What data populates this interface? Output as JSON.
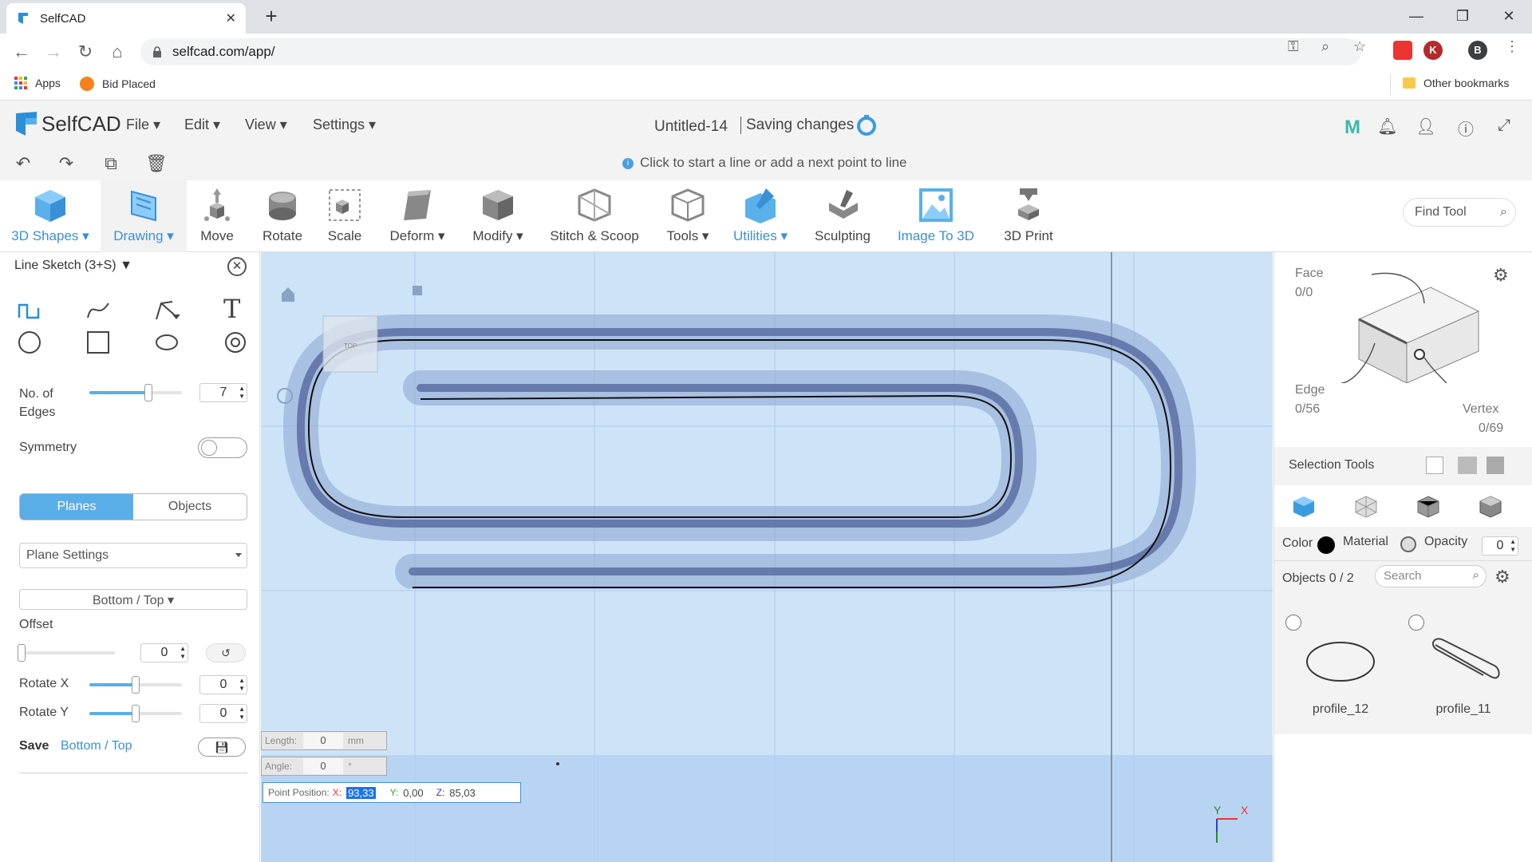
{
  "browser": {
    "tab_title": "SelfCAD",
    "url": "selfcad.com/app/",
    "bookmarks": {
      "apps": "Apps",
      "bid_placed": "Bid Placed",
      "other": "Other bookmarks"
    },
    "ext_k": "K",
    "profile": "B"
  },
  "app": {
    "logo": "SelfCAD",
    "menus": [
      "File",
      "Edit",
      "View",
      "Settings"
    ],
    "doc_title": "Untitled-14",
    "saving": "Saving changes",
    "hint": "Click to start a line or add a next point to line"
  },
  "toolbar": {
    "tools": [
      {
        "label": "3D Shapes",
        "icon": "cube-icon",
        "dropdown": true,
        "blue": true
      },
      {
        "label": "Drawing",
        "icon": "drawing-icon",
        "dropdown": true,
        "blue": true
      },
      {
        "label": "Move",
        "icon": "move-icon"
      },
      {
        "label": "Rotate",
        "icon": "rotate-icon"
      },
      {
        "label": "Scale",
        "icon": "scale-icon"
      },
      {
        "label": "Deform",
        "icon": "deform-icon",
        "dropdown": true
      },
      {
        "label": "Modify",
        "icon": "modify-icon",
        "dropdown": true
      },
      {
        "label": "Stitch & Scoop",
        "icon": "stitch-icon"
      },
      {
        "label": "Tools",
        "icon": "tools-icon",
        "dropdown": true
      },
      {
        "label": "Utilities",
        "icon": "utilities-icon",
        "dropdown": true,
        "blue": true
      },
      {
        "label": "Sculpting",
        "icon": "sculpting-icon"
      },
      {
        "label": "Image To 3D",
        "icon": "image-to-3d-icon",
        "blue": true
      },
      {
        "label": "3D Print",
        "icon": "3d-print-icon"
      }
    ],
    "find_tool": "Find Tool"
  },
  "left_panel": {
    "title": "Line Sketch (3+S)",
    "edges_label": "No. of Edges",
    "edges_value": "7",
    "edges_fraction": 0.6,
    "symmetry_label": "Symmetry",
    "symmetry_on": false,
    "seg_planes": "Planes",
    "seg_objects": "Objects",
    "plane_settings": "Plane Settings",
    "plane_select": "Bottom / Top",
    "offset_label": "Offset",
    "offset_value": "0",
    "rotate_x_label": "Rotate X",
    "rotate_x_value": "0",
    "rotate_y_label": "Rotate Y",
    "rotate_y_value": "0",
    "save_label": "Save",
    "save_plane": "Bottom / Top"
  },
  "viewport": {
    "length_label": "Length:",
    "length_value": "0",
    "length_unit": "mm",
    "angle_label": "Angle:",
    "angle_value": "0",
    "angle_unit": "°",
    "point_label": "Point Position:",
    "x_label": "X:",
    "x_value": "93,33",
    "y_label": "Y:",
    "y_value": "0,00",
    "z_label": "Z:",
    "z_value": "85,03",
    "cube_face": "TOP",
    "axis_y": "Y",
    "axis_x": "X"
  },
  "right_panel": {
    "face_label": "Face",
    "face_value": "0/0",
    "edge_label": "Edge",
    "edge_value": "0/56",
    "vertex_label": "Vertex",
    "vertex_value": "0/69",
    "selection_tools": "Selection Tools",
    "color_label": "Color",
    "color_value": "#000000",
    "material_label": "Material",
    "opacity_label": "Opacity",
    "opacity_value": "0",
    "objects_label": "Objects 0 / 2",
    "search_placeholder": "Search",
    "objects": [
      {
        "name": "profile_12"
      },
      {
        "name": "profile_11"
      }
    ]
  }
}
